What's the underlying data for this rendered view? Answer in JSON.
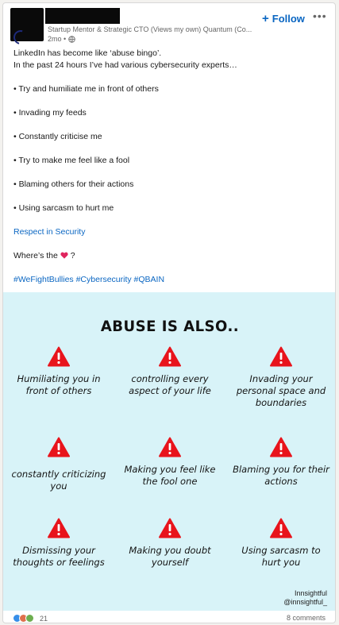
{
  "post": {
    "author": {
      "headline": "Startup Mentor & Strategic CTO (Views my own) Quantum (Co...",
      "time": "2mo •"
    },
    "follow_label": "Follow",
    "follow_plus": "+",
    "more_label": "•••",
    "lines": {
      "line1": "LinkedIn has become like ‘abuse bingo’.",
      "line2": "In the past 24 hours I’ve had various cybersecurity experts…",
      "bullet1": "• Try and humiliate me in front of others",
      "bullet2": "• Invading my feeds",
      "bullet3": "• Constantly criticise me",
      "bullet4": "• Try to make me feel like a fool",
      "bullet5": "• Blaming others for their actions",
      "bullet6": "• Using sarcasm to hurt me",
      "link": "Respect in Security",
      "question_pre": "Where’s the",
      "question_post": "?",
      "hashtags": "#WeFightBullies #Cybersecurity #QBAIN"
    },
    "image": {
      "title": "ABUSE IS ALSO..",
      "items": [
        "Humiliating you in front of others",
        "controlling every aspect of your life",
        "Invading your personal space and boundaries",
        "constantly criticizing you",
        "Making you feel like the fool one",
        "Blaming you for their actions",
        "Dismissing your thoughts or feelings",
        "Making you doubt yourself",
        "Using sarcasm to hurt you"
      ],
      "credit_name": "Innsightful",
      "credit_handle": "@innsightful_"
    },
    "footer": {
      "reaction_count": "21",
      "comments": "8 comments"
    },
    "colors": {
      "accent": "#0a66c2",
      "warning_red": "#e8141c",
      "image_bg": "#d8f3f8"
    }
  }
}
